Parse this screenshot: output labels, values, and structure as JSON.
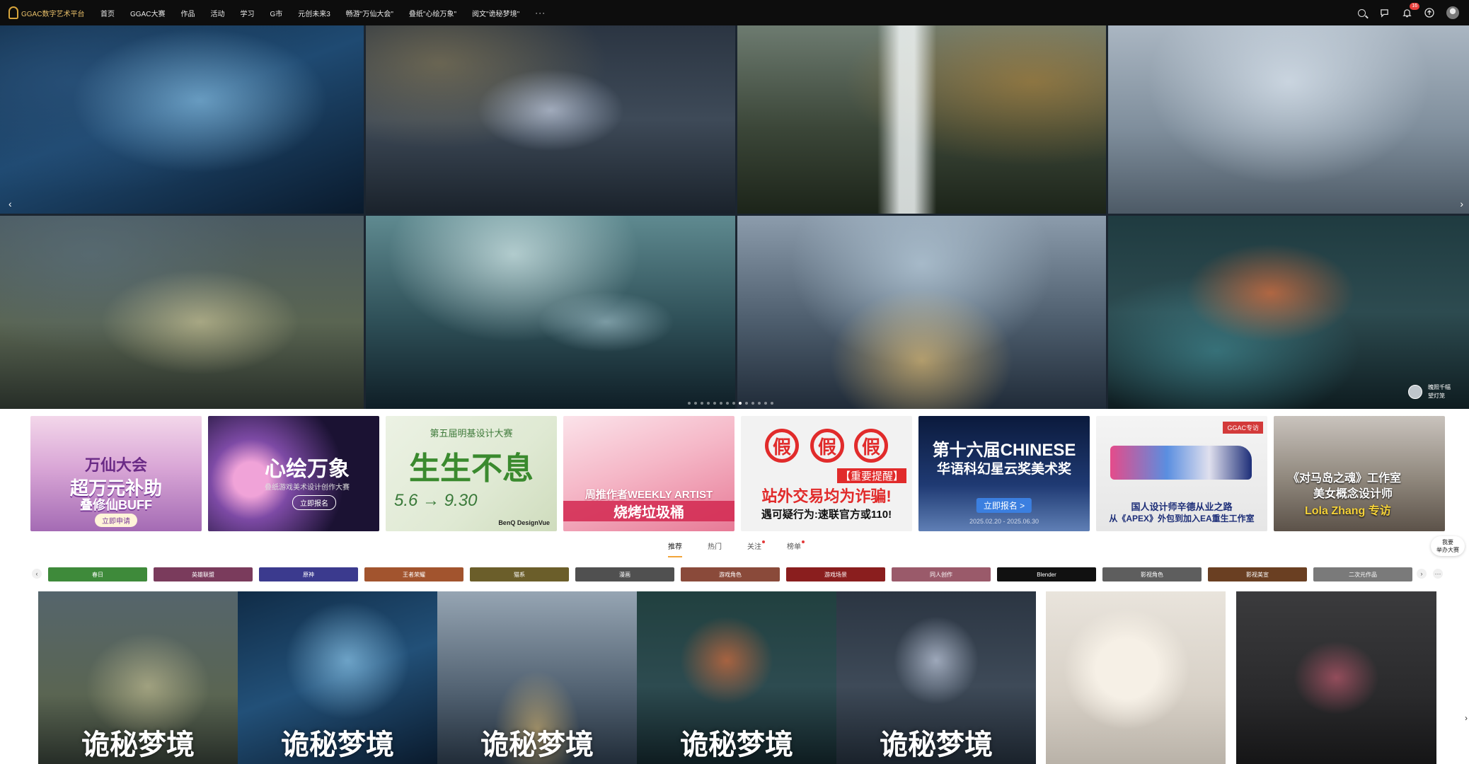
{
  "nav": {
    "logo_text": "GGAC数字艺术平台",
    "items": [
      "首页",
      "GGAC大赛",
      "作品",
      "活动",
      "学习",
      "G市",
      "元创未来3",
      "畅游\"万仙大会\"",
      "叠纸\"心绘万象\"",
      "阅文\"诡秘梦境\""
    ],
    "more": "···",
    "notification_badge": "16"
  },
  "hero": {
    "credit_name": "魄照千幅",
    "credit_title": "望灯笼",
    "prev_arrow": "‹",
    "next_arrow": "›"
  },
  "banners": [
    {
      "title": "超万元补助",
      "top": "万仙大会",
      "sub": "叠修仙BUFF",
      "button": "立即申请"
    },
    {
      "title": "心绘万象",
      "sub": "叠纸游戏美术设计创作大赛",
      "button": "立即报名"
    },
    {
      "title": "生生不息",
      "top": "第五届明基设计大赛",
      "dates": "5.6 → 9.30",
      "brand": "BenQ  DesignVue"
    },
    {
      "title": "烧烤垃圾桶",
      "sub": "周推作者WEEKLY ARTIST"
    },
    {
      "stamp": "假",
      "alert": "【重要提醒】",
      "title": "站外交易均为诈骗!",
      "sub": "遇可疑行为:速联官方或110!"
    },
    {
      "title": "第十六届CHINESE",
      "sub": "华语科幻星云奖美术奖",
      "button": "立即报名 >",
      "dates": "2025.02.20 - 2025.06.30"
    },
    {
      "tag": "GGAC专访",
      "title": "国人设计师辛德从业之路",
      "sub": "从《APEX》外包到加入EA重生工作室"
    },
    {
      "title": "《对马岛之魂》工作室",
      "sub": "美女概念设计师",
      "name": "Lola Zhang 专访"
    }
  ],
  "tabs": [
    {
      "label": "推荐",
      "active": true,
      "dot": false
    },
    {
      "label": "热门",
      "active": false,
      "dot": false
    },
    {
      "label": "关注",
      "active": false,
      "dot": true
    },
    {
      "label": "榜单",
      "active": false,
      "dot": true
    }
  ],
  "side_float": {
    "line1": "我要",
    "line2": "举办大赛"
  },
  "categories": [
    {
      "label": "春日",
      "color": "#3e8a3a"
    },
    {
      "label": "英雄联盟",
      "color": "#7a3b5c"
    },
    {
      "label": "原神",
      "color": "#3b3a8e"
    },
    {
      "label": "王者荣耀",
      "color": "#a2542e"
    },
    {
      "label": "猫系",
      "color": "#6b5e2a"
    },
    {
      "label": "漫画",
      "color": "#505050"
    },
    {
      "label": "游戏角色",
      "color": "#8a4a3a"
    },
    {
      "label": "游戏场景",
      "color": "#8a1e1e"
    },
    {
      "label": "同人创作",
      "color": "#9a5a6a"
    },
    {
      "label": "Blender",
      "color": "#111111"
    },
    {
      "label": "影视角色",
      "color": "#5e5e5e"
    },
    {
      "label": "影视美宣",
      "color": "#6a3f22"
    },
    {
      "label": "二次元作品",
      "color": "#7a7a7a"
    }
  ],
  "gallery": {
    "watermark": "诡秘梦境"
  }
}
